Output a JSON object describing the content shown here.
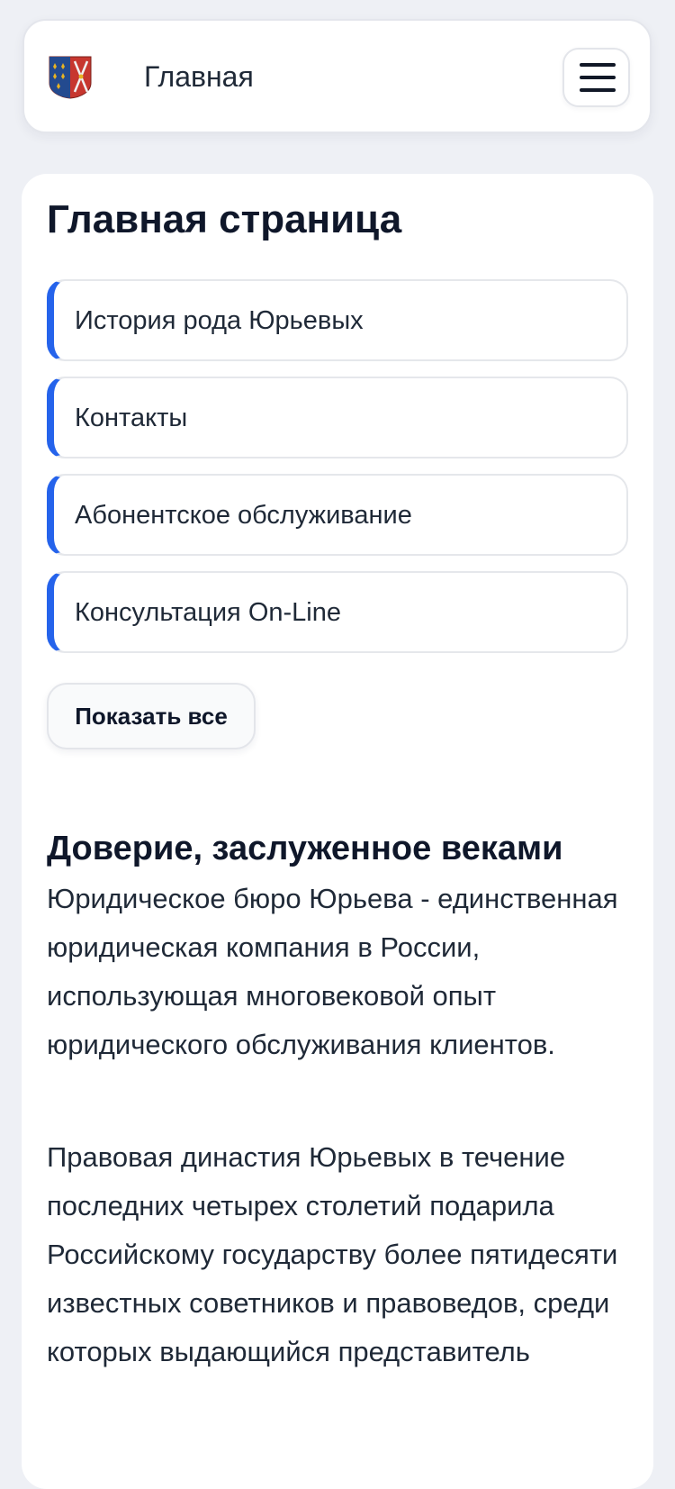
{
  "header": {
    "logo_icon": "coat-of-arms-icon",
    "title": "Главная",
    "menu_icon": "hamburger-menu-icon"
  },
  "main": {
    "page_title": "Главная страница",
    "nav_items": [
      {
        "label": "История рода Юрьевых"
      },
      {
        "label": "Контакты"
      },
      {
        "label": "Абонентское обслуживание"
      },
      {
        "label": "Консультация On-Line"
      }
    ],
    "show_all_label": "Показать все",
    "section_title": "Доверие, заслуженное веками",
    "paragraphs": [
      "Юридическое бюро Юрьева - единственная юридическая компания в России, использующая многовековой опыт юридического обслуживания клиентов.",
      "Правовая династия Юрьевых в течение последних четырех столетий подарила Российскому государству более пятидесяти известных советников и правоведов, среди которых выдающийся представитель"
    ]
  },
  "colors": {
    "accent": "#2563eb",
    "background": "#eef0f5",
    "card": "#ffffff",
    "text": "#1f2937",
    "heading": "#0f172a",
    "border": "#e5e7eb"
  }
}
